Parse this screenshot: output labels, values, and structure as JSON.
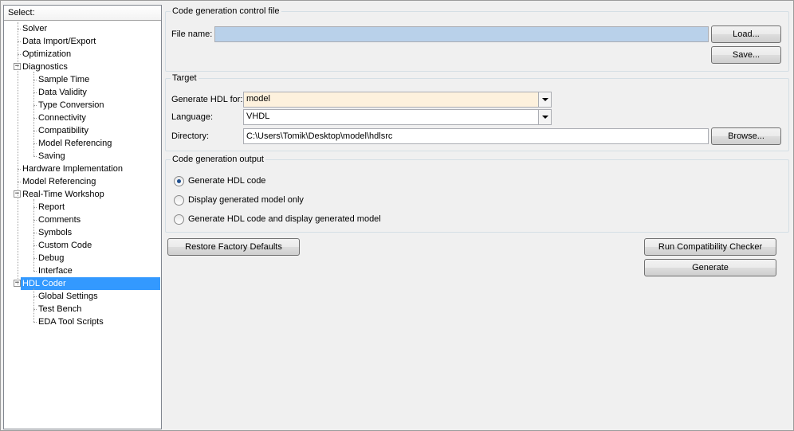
{
  "tree": {
    "header": "Select:",
    "items": [
      {
        "label": "Solver",
        "level": 1
      },
      {
        "label": "Data Import/Export",
        "level": 1
      },
      {
        "label": "Optimization",
        "level": 1
      },
      {
        "label": "Diagnostics",
        "level": 1,
        "expanded": true
      },
      {
        "label": "Sample Time",
        "level": 2
      },
      {
        "label": "Data Validity",
        "level": 2
      },
      {
        "label": "Type Conversion",
        "level": 2
      },
      {
        "label": "Connectivity",
        "level": 2
      },
      {
        "label": "Compatibility",
        "level": 2
      },
      {
        "label": "Model Referencing",
        "level": 2
      },
      {
        "label": "Saving",
        "level": 2
      },
      {
        "label": "Hardware Implementation",
        "level": 1
      },
      {
        "label": "Model Referencing",
        "level": 1
      },
      {
        "label": "Real-Time Workshop",
        "level": 1,
        "expanded": true
      },
      {
        "label": "Report",
        "level": 2
      },
      {
        "label": "Comments",
        "level": 2
      },
      {
        "label": "Symbols",
        "level": 2
      },
      {
        "label": "Custom Code",
        "level": 2
      },
      {
        "label": "Debug",
        "level": 2
      },
      {
        "label": "Interface",
        "level": 2
      },
      {
        "label": "HDL Coder",
        "level": 1,
        "expanded": true,
        "selected": true
      },
      {
        "label": "Global Settings",
        "level": 2
      },
      {
        "label": "Test Bench",
        "level": 2
      },
      {
        "label": "EDA Tool Scripts",
        "level": 2
      }
    ]
  },
  "control_file": {
    "title": "Code generation control file",
    "file_name_label": "File name:",
    "file_name_value": "",
    "load_label": "Load...",
    "save_label": "Save..."
  },
  "target": {
    "title": "Target",
    "generate_for_label": "Generate HDL for:",
    "generate_for_value": "model",
    "language_label": "Language:",
    "language_value": "VHDL",
    "directory_label": "Directory:",
    "directory_value": "C:\\Users\\Tomik\\Desktop\\model\\hdlsrc",
    "browse_label": "Browse..."
  },
  "output": {
    "title": "Code generation output",
    "options": [
      {
        "label": "Generate HDL code",
        "checked": true
      },
      {
        "label": "Display generated model only",
        "checked": false
      },
      {
        "label": "Generate HDL code and display generated model",
        "checked": false
      }
    ]
  },
  "buttons": {
    "restore": "Restore Factory Defaults",
    "compat": "Run Compatibility Checker",
    "generate": "Generate"
  },
  "colors": {
    "selection": "#3399ff",
    "file_field": "#b9d1ea",
    "generate_for_field": "#fdf1dd"
  }
}
